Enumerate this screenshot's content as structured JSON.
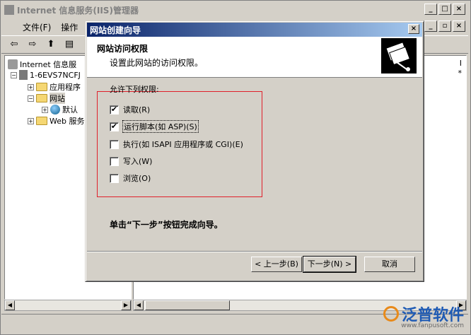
{
  "main_window": {
    "title": "Internet 信息服务(IIS)管理器",
    "controls": [
      "_",
      "□",
      "×"
    ],
    "menu": [
      "文件(F)",
      "操作"
    ],
    "child_controls": [
      "_",
      "▫",
      "×"
    ],
    "tree": {
      "root": "Internet 信息服",
      "server": "1-6EVS7NCFJ",
      "app_pools": "应用程序",
      "websites": "网站",
      "default_site": "默认",
      "web_ext": "Web 服务"
    },
    "right_header_marker": "I",
    "right_star": "*"
  },
  "dialog": {
    "title": "网站创建向导",
    "close": "×",
    "header_title": "网站访问权限",
    "header_subtitle": "设置此网站的访问权限。",
    "group_label": "允许下列权限:",
    "permissions": [
      {
        "label": "读取(R)",
        "checked": true,
        "mark": "✔"
      },
      {
        "label": "运行脚本(如 ASP)(S)",
        "checked": true,
        "mark": "✔"
      },
      {
        "label": "执行(如 ISAPI 应用程序或 CGI)(E)",
        "checked": false,
        "mark": ""
      },
      {
        "label": "写入(W)",
        "checked": false,
        "mark": ""
      },
      {
        "label": "浏览(O)",
        "checked": false,
        "mark": ""
      }
    ],
    "finish_hint": "单击“下一步”按钮完成向导。",
    "buttons": {
      "back": "< 上一步(B)",
      "next": "下一步(N) >",
      "cancel": "取消"
    }
  },
  "watermark": {
    "brand": "泛普软件",
    "url": "www.fanpusoft.com"
  },
  "colors": {
    "dialog_title": "#0a246a",
    "highlight_box": "#e0202a",
    "brand": "#1f5bb4"
  }
}
